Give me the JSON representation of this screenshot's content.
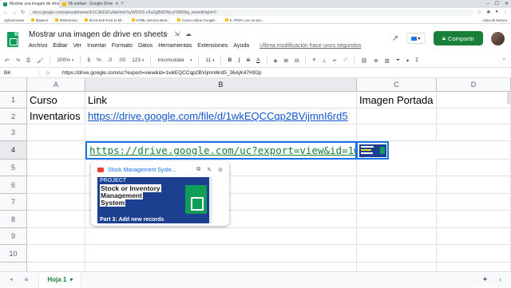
{
  "browser": {
    "tabs": [
      {
        "label": "Mostrar una imagen de drive en",
        "active": true,
        "color": "#0f9d58"
      },
      {
        "label": "Mi unidad - Google Drive",
        "active": false,
        "color": "#fbbc04"
      }
    ],
    "new_tab": "+",
    "url": "docs.google.com/spreadsheets/d/1C3EEEFyAkeVekTsyWDIXS-cKaZgBiSDNj-q7l8M3kg_ew/edit#gid=0",
    "bookmarks": [
      "Aplicaciones",
      "Basecs",
      "Referencia",
      "IDAS-018 Post to Bl...",
      "HTML Service Best...",
      "Curso online Google...",
      "K. PDFs con un bot..."
    ],
    "reading_list": "Lista de lectura"
  },
  "doc": {
    "title": "Mostrar una imagen de drive en sheets",
    "menus": [
      "Archivo",
      "Editar",
      "Ver",
      "Insertar",
      "Formato",
      "Datos",
      "Herramientas",
      "Extensiones",
      "Ayuda"
    ],
    "last_edit": "Última modificación hace unos segundos",
    "share_label": "Compartir"
  },
  "toolbar": {
    "zoom": "200%",
    "currency": "$",
    "percent": "%",
    "decimal_less": ".0",
    "decimal_more": ".00",
    "number_format": "123",
    "font": "Inconsolata",
    "font_size": "11"
  },
  "formula_bar": {
    "name_box": "B4",
    "fx": "fx",
    "content": "https://drive.google.com/uc?export=view&id=1wkEQCCqp2BVijmnI6rd5_36AjK47H92p"
  },
  "grid": {
    "columns": [
      "A",
      "B",
      "C",
      "D"
    ],
    "rows": [
      "1",
      "2",
      "3",
      "4",
      "5",
      "6",
      "7",
      "8",
      "9",
      "10"
    ],
    "cells": {
      "a1": "Curso",
      "b1": "Link",
      "c1": "Imagen Portada",
      "a2": "Inventarios",
      "b2": "https://drive.google.com/file/d/1wkEQCCqp2BVijmnI6rd5",
      "b4": "https://drive.google.com/uc?export=view&id=1wkEQCCqp2BVijmnI6rd5"
    }
  },
  "preview": {
    "title": "Stock Management Syste...",
    "image": {
      "project": "PROJECT",
      "line1": "Stock or Inventory",
      "line2": "Management",
      "line3": "System",
      "part": "Part 3: Add new records"
    }
  },
  "sheets": {
    "tab_label": "Hoja 1"
  },
  "colors": {
    "accent": "#1a73e8",
    "share": "#188038",
    "link": "#1155cc",
    "formula_text": "#188038"
  }
}
